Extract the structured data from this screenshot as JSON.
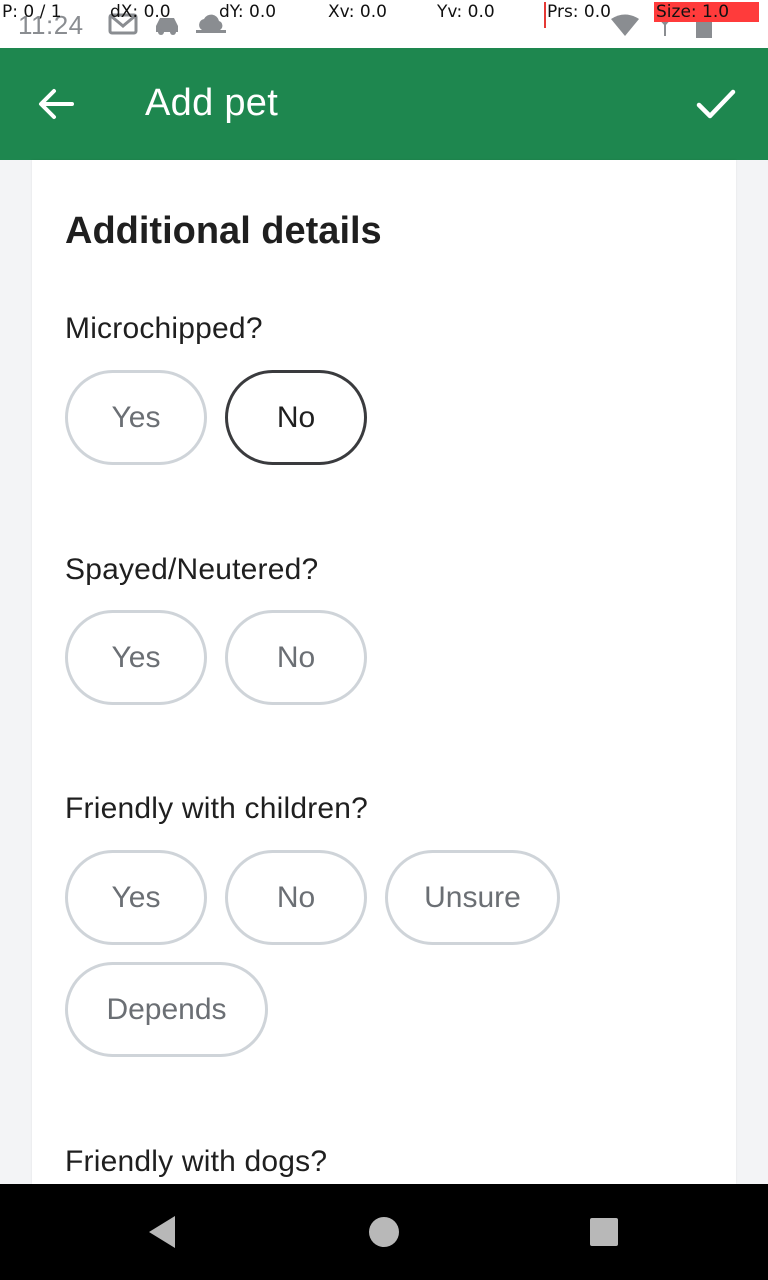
{
  "status_bar": {
    "time": "11:24",
    "icons": [
      "gmail-icon",
      "car-icon",
      "cloud-icon",
      "wifi-icon",
      "signal-icon",
      "battery-icon"
    ]
  },
  "debug_overlay": {
    "p": "P: 0 / 1",
    "dx": "dX: 0.0",
    "dy": "dY: 0.0",
    "xv": "Xv: 0.0",
    "yv": "Yv: 0.0",
    "prs": "Prs: 0.0",
    "size": "Size: 1.0"
  },
  "app_bar": {
    "title": "Add pet",
    "back_icon": "arrow-left-icon",
    "confirm_icon": "check-icon",
    "color": "#1e874f"
  },
  "card": {
    "section_title": "Additional details",
    "questions": [
      {
        "label": "Microchipped?",
        "options": [
          "Yes",
          "No"
        ],
        "selected": "No"
      },
      {
        "label": "Spayed/Neutered?",
        "options": [
          "Yes",
          "No"
        ],
        "selected": null
      },
      {
        "label": "Friendly with children?",
        "options": [
          "Yes",
          "No",
          "Unsure",
          "Depends"
        ],
        "selected": null
      },
      {
        "label": "Friendly with dogs?",
        "options": [],
        "selected": null
      }
    ]
  },
  "nav_bar": {
    "buttons": [
      "back-triangle-icon",
      "home-circle-icon",
      "recents-square-icon"
    ]
  }
}
